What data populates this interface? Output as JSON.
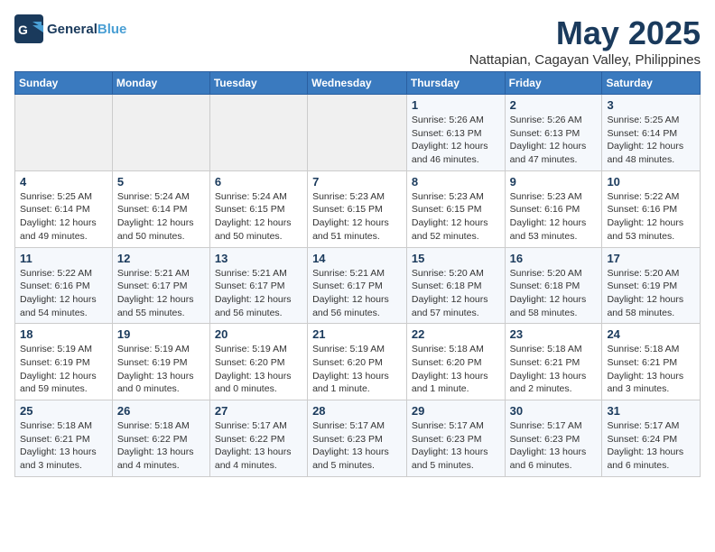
{
  "header": {
    "logo_general": "General",
    "logo_blue": "Blue",
    "month_title": "May 2025",
    "location": "Nattapian, Cagayan Valley, Philippines"
  },
  "weekdays": [
    "Sunday",
    "Monday",
    "Tuesday",
    "Wednesday",
    "Thursday",
    "Friday",
    "Saturday"
  ],
  "weeks": [
    [
      {
        "day": "",
        "info": ""
      },
      {
        "day": "",
        "info": ""
      },
      {
        "day": "",
        "info": ""
      },
      {
        "day": "",
        "info": ""
      },
      {
        "day": "1",
        "info": "Sunrise: 5:26 AM\nSunset: 6:13 PM\nDaylight: 12 hours\nand 46 minutes."
      },
      {
        "day": "2",
        "info": "Sunrise: 5:26 AM\nSunset: 6:13 PM\nDaylight: 12 hours\nand 47 minutes."
      },
      {
        "day": "3",
        "info": "Sunrise: 5:25 AM\nSunset: 6:14 PM\nDaylight: 12 hours\nand 48 minutes."
      }
    ],
    [
      {
        "day": "4",
        "info": "Sunrise: 5:25 AM\nSunset: 6:14 PM\nDaylight: 12 hours\nand 49 minutes."
      },
      {
        "day": "5",
        "info": "Sunrise: 5:24 AM\nSunset: 6:14 PM\nDaylight: 12 hours\nand 50 minutes."
      },
      {
        "day": "6",
        "info": "Sunrise: 5:24 AM\nSunset: 6:15 PM\nDaylight: 12 hours\nand 50 minutes."
      },
      {
        "day": "7",
        "info": "Sunrise: 5:23 AM\nSunset: 6:15 PM\nDaylight: 12 hours\nand 51 minutes."
      },
      {
        "day": "8",
        "info": "Sunrise: 5:23 AM\nSunset: 6:15 PM\nDaylight: 12 hours\nand 52 minutes."
      },
      {
        "day": "9",
        "info": "Sunrise: 5:23 AM\nSunset: 6:16 PM\nDaylight: 12 hours\nand 53 minutes."
      },
      {
        "day": "10",
        "info": "Sunrise: 5:22 AM\nSunset: 6:16 PM\nDaylight: 12 hours\nand 53 minutes."
      }
    ],
    [
      {
        "day": "11",
        "info": "Sunrise: 5:22 AM\nSunset: 6:16 PM\nDaylight: 12 hours\nand 54 minutes."
      },
      {
        "day": "12",
        "info": "Sunrise: 5:21 AM\nSunset: 6:17 PM\nDaylight: 12 hours\nand 55 minutes."
      },
      {
        "day": "13",
        "info": "Sunrise: 5:21 AM\nSunset: 6:17 PM\nDaylight: 12 hours\nand 56 minutes."
      },
      {
        "day": "14",
        "info": "Sunrise: 5:21 AM\nSunset: 6:17 PM\nDaylight: 12 hours\nand 56 minutes."
      },
      {
        "day": "15",
        "info": "Sunrise: 5:20 AM\nSunset: 6:18 PM\nDaylight: 12 hours\nand 57 minutes."
      },
      {
        "day": "16",
        "info": "Sunrise: 5:20 AM\nSunset: 6:18 PM\nDaylight: 12 hours\nand 58 minutes."
      },
      {
        "day": "17",
        "info": "Sunrise: 5:20 AM\nSunset: 6:19 PM\nDaylight: 12 hours\nand 58 minutes."
      }
    ],
    [
      {
        "day": "18",
        "info": "Sunrise: 5:19 AM\nSunset: 6:19 PM\nDaylight: 12 hours\nand 59 minutes."
      },
      {
        "day": "19",
        "info": "Sunrise: 5:19 AM\nSunset: 6:19 PM\nDaylight: 13 hours\nand 0 minutes."
      },
      {
        "day": "20",
        "info": "Sunrise: 5:19 AM\nSunset: 6:20 PM\nDaylight: 13 hours\nand 0 minutes."
      },
      {
        "day": "21",
        "info": "Sunrise: 5:19 AM\nSunset: 6:20 PM\nDaylight: 13 hours\nand 1 minute."
      },
      {
        "day": "22",
        "info": "Sunrise: 5:18 AM\nSunset: 6:20 PM\nDaylight: 13 hours\nand 1 minute."
      },
      {
        "day": "23",
        "info": "Sunrise: 5:18 AM\nSunset: 6:21 PM\nDaylight: 13 hours\nand 2 minutes."
      },
      {
        "day": "24",
        "info": "Sunrise: 5:18 AM\nSunset: 6:21 PM\nDaylight: 13 hours\nand 3 minutes."
      }
    ],
    [
      {
        "day": "25",
        "info": "Sunrise: 5:18 AM\nSunset: 6:21 PM\nDaylight: 13 hours\nand 3 minutes."
      },
      {
        "day": "26",
        "info": "Sunrise: 5:18 AM\nSunset: 6:22 PM\nDaylight: 13 hours\nand 4 minutes."
      },
      {
        "day": "27",
        "info": "Sunrise: 5:17 AM\nSunset: 6:22 PM\nDaylight: 13 hours\nand 4 minutes."
      },
      {
        "day": "28",
        "info": "Sunrise: 5:17 AM\nSunset: 6:23 PM\nDaylight: 13 hours\nand 5 minutes."
      },
      {
        "day": "29",
        "info": "Sunrise: 5:17 AM\nSunset: 6:23 PM\nDaylight: 13 hours\nand 5 minutes."
      },
      {
        "day": "30",
        "info": "Sunrise: 5:17 AM\nSunset: 6:23 PM\nDaylight: 13 hours\nand 6 minutes."
      },
      {
        "day": "31",
        "info": "Sunrise: 5:17 AM\nSunset: 6:24 PM\nDaylight: 13 hours\nand 6 minutes."
      }
    ]
  ]
}
